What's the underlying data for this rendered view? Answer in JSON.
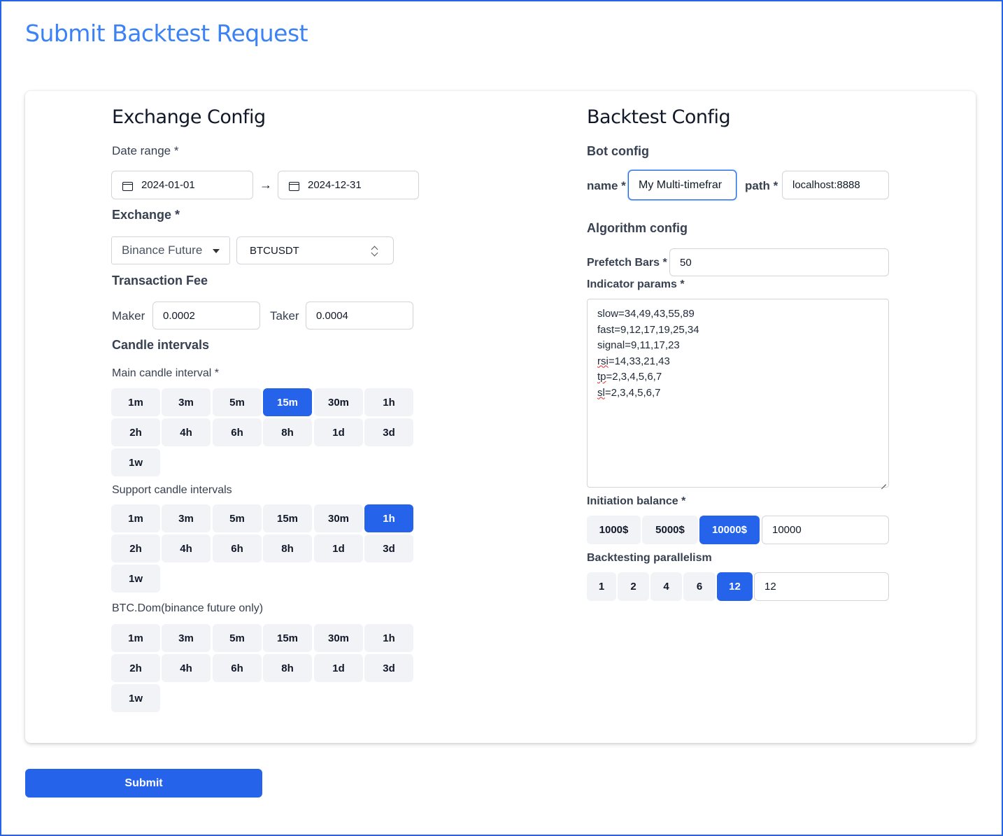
{
  "page": {
    "title": "Submit Backtest Request"
  },
  "exchange_config": {
    "title": "Exchange Config",
    "date_range_label": "Date range *",
    "start_date": "2024-01-01",
    "end_date": "2024-12-31",
    "exchange_label": "Exchange *",
    "exchange_value": "Binance Future",
    "symbol_value": "BTCUSDT",
    "fee_label": "Transaction Fee",
    "maker_label": "Maker",
    "maker_value": "0.0002",
    "taker_label": "Taker",
    "taker_value": "0.0004",
    "candle_title": "Candle intervals",
    "main_label": "Main candle interval *",
    "support_label": "Support candle intervals",
    "btcdom_label": "BTC.Dom(binance future only)",
    "interval_options": [
      "1m",
      "3m",
      "5m",
      "15m",
      "30m",
      "1h",
      "2h",
      "4h",
      "6h",
      "8h",
      "1d",
      "3d",
      "1w"
    ],
    "main_selected": "15m",
    "support_selected": "1h"
  },
  "backtest_config": {
    "title": "Backtest Config",
    "bot_title": "Bot config",
    "name_label": "name *",
    "name_value": "My Multi-timefrar",
    "path_label": "path *",
    "path_value": "localhost:8888",
    "algo_title": "Algorithm config",
    "prefetch_label": "Prefetch Bars *",
    "prefetch_value": "50",
    "indicator_label": "Indicator params *",
    "indicator_lines": [
      {
        "key": "slow",
        "rest": "=34,49,43,55,89",
        "flagged": false
      },
      {
        "key": "fast",
        "rest": "=9,12,17,19,25,34",
        "flagged": false
      },
      {
        "key": "signal",
        "rest": "=9,11,17,23",
        "flagged": false
      },
      {
        "key": "rsi",
        "rest": "=14,33,21,43",
        "flagged": true
      },
      {
        "key": "tp",
        "rest": "=2,3,4,5,6,7",
        "flagged": true
      },
      {
        "key": "sl",
        "rest": "=2,3,4,5,6,7",
        "flagged": true
      }
    ],
    "balance_label": "Initiation balance *",
    "balance_options": [
      "1000$",
      "5000$",
      "10000$"
    ],
    "balance_selected": "10000$",
    "balance_value": "10000",
    "parallel_label": "Backtesting parallelism",
    "parallel_options": [
      "1",
      "2",
      "4",
      "6",
      "12"
    ],
    "parallel_selected": "12",
    "parallel_value": "12"
  },
  "submit_label": "Submit",
  "colors": {
    "accent": "#2563eb",
    "title": "#3b82f6",
    "chip_bg": "#f1f3f7"
  }
}
